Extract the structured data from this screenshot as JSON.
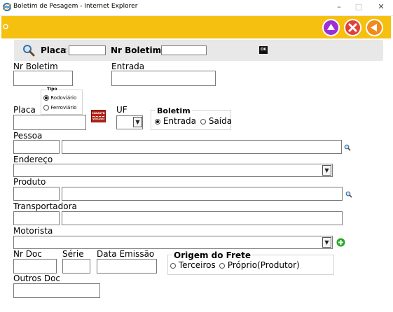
{
  "window": {
    "title": "Boletim de Pesagem - Internet Explorer",
    "minimize": "–",
    "maximize": "□",
    "close": "✕"
  },
  "colors": {
    "toolbar": "#f5c010",
    "btn_up": "#9b2ed6",
    "btn_cancel": "#e0413a",
    "btn_back": "#f08a1c",
    "add": "#27a827"
  },
  "search": {
    "placa_label": "Placa",
    "colon": ":",
    "placa_value": "",
    "nr_boletim_label": "Nr Boletim",
    "nr_boletim_value": "",
    "ok_label": "OK"
  },
  "form": {
    "nr_boletim": {
      "label": "Nr Boletim",
      "value": ""
    },
    "entrada": {
      "label": "Entrada",
      "value": ""
    },
    "tipo": {
      "legend": "Tipo",
      "options": [
        "Rodoviário",
        "Ferroviário"
      ],
      "selected": "Rodoviário"
    },
    "placa": {
      "label": "Placa",
      "value": ""
    },
    "placa_badge": {
      "line1": "CADASTRO",
      "line2": "VEICULO"
    },
    "uf": {
      "label": "UF",
      "value": ""
    },
    "boletim": {
      "legend": "Boletim",
      "options": [
        "Entrada",
        "Saída"
      ],
      "selected": "Entrada"
    },
    "pessoa": {
      "label": "Pessoa",
      "code": "",
      "name": ""
    },
    "endereco": {
      "label": "Endereço",
      "value": ""
    },
    "produto": {
      "label": "Produto",
      "code": "",
      "name": ""
    },
    "transportadora": {
      "label": "Transportadora",
      "code": "",
      "name": ""
    },
    "motorista": {
      "label": "Motorista",
      "value": ""
    },
    "nr_doc": {
      "label": "Nr Doc",
      "value": ""
    },
    "serie": {
      "label": "Série",
      "value": ""
    },
    "data_emissao": {
      "label": "Data Emissão",
      "value": ""
    },
    "origem_frete": {
      "legend": "Origem do Frete",
      "options": [
        "Terceiros",
        "Próprio(Produtor)"
      ],
      "selected": ""
    },
    "outros_doc": {
      "label": "Outros Doc",
      "value": ""
    }
  }
}
